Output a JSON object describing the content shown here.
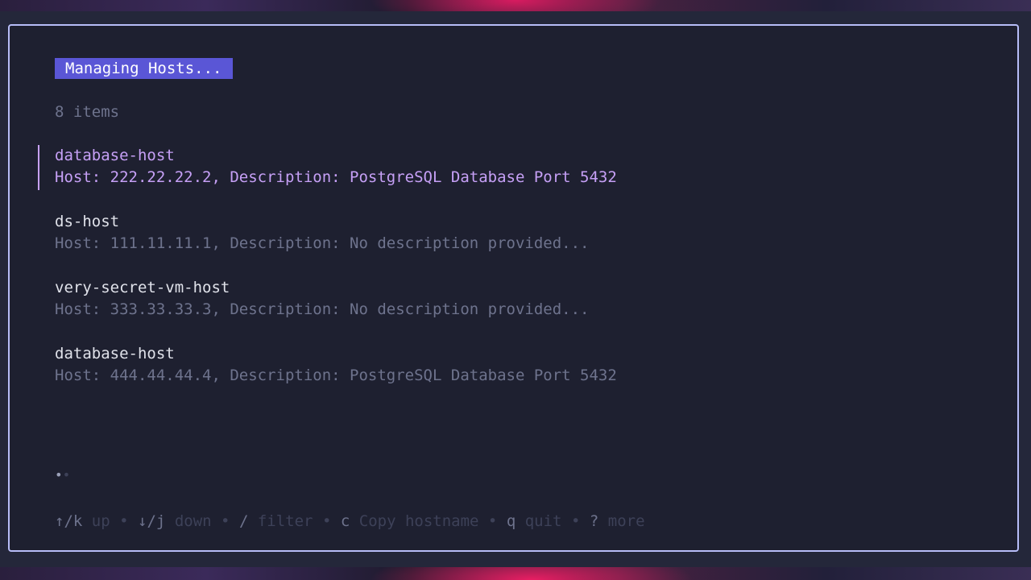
{
  "title": "Managing Hosts...",
  "item_count": "8 items",
  "hosts": [
    {
      "name": "database-host",
      "details": "Host: 222.22.22.2, Description: PostgreSQL Database Port 5432",
      "selected": true
    },
    {
      "name": "ds-host",
      "details": "Host: 111.11.11.1, Description: No description provided...",
      "selected": false
    },
    {
      "name": "very-secret-vm-host",
      "details": "Host: 333.33.33.3, Description: No description provided...",
      "selected": false
    },
    {
      "name": "database-host",
      "details": "Host: 444.44.44.4, Description: PostgreSQL Database Port 5432",
      "selected": false
    }
  ],
  "pagination": {
    "active_dot": "•",
    "inactive_dot": "•"
  },
  "help": [
    {
      "key": "↑/k",
      "desc": "up"
    },
    {
      "key": "↓/j",
      "desc": "down"
    },
    {
      "key": "/",
      "desc": "filter"
    },
    {
      "key": "c",
      "desc": "Copy hostname"
    },
    {
      "key": "q",
      "desc": "quit"
    },
    {
      "key": "?",
      "desc": "more"
    }
  ],
  "help_separator": "•",
  "colors": {
    "accent": "#c6a0f6",
    "title_bg": "#5a56d6",
    "border": "#b7bdf8",
    "muted": "#6e738d",
    "background": "#1e2030"
  }
}
